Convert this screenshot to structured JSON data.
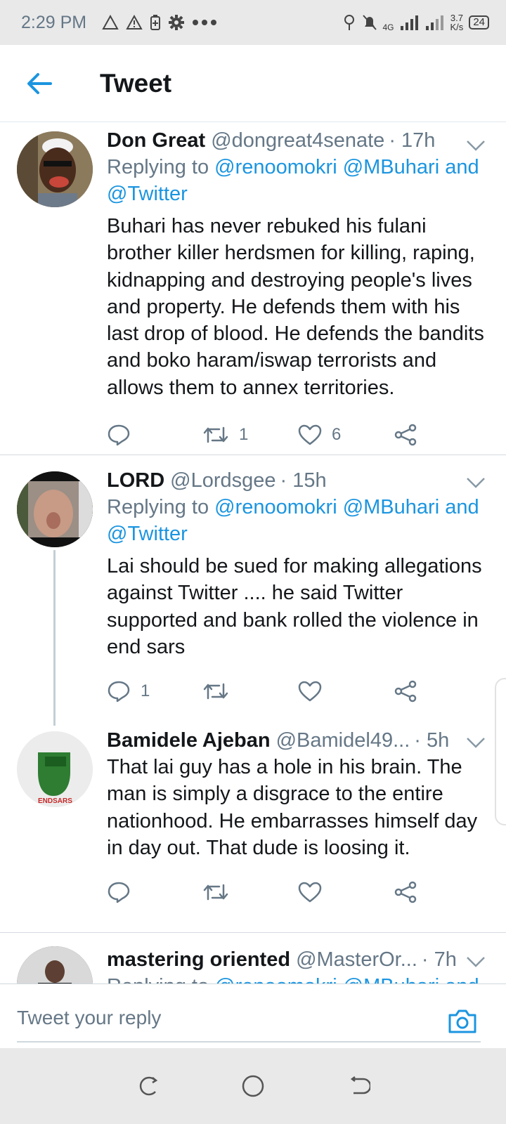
{
  "statusbar": {
    "time": "2:29 PM",
    "left_icons": [
      "warning-outline-icon",
      "warning-icon",
      "battery-saver-icon",
      "gear-icon",
      "more-dots-icon"
    ],
    "network": "4G",
    "speed_value": "3.7",
    "speed_unit": "K/s",
    "battery": "24"
  },
  "header": {
    "title": "Tweet"
  },
  "tweets": [
    {
      "name": "Don Great",
      "handle": "@dongreat4senate",
      "time": "· 17h",
      "reply_prefix": "Replying to",
      "reply_to_line1": "@renoomokri @MBuhari and",
      "reply_to_line2": "@Twitter",
      "text": "Buhari has never rebuked his fulani brother killer herdsmen for killing, raping, kidnapping and destroying people's lives and property. He defends them with his last drop of blood. He defends the bandits and boko haram/iswap terrorists and allows them to annex territories.",
      "replies": "",
      "retweets": "1",
      "likes": "6"
    },
    {
      "name": "LORD",
      "handle": "@Lordsgee",
      "time": "· 15h",
      "reply_prefix": "Replying to",
      "reply_to_line1": "@renoomokri @MBuhari and",
      "reply_to_line2": "@Twitter",
      "text": "Lai should be sued for making allegations against Twitter .... he said Twitter supported and bank rolled the violence in end sars",
      "replies": "1",
      "retweets": "",
      "likes": ""
    },
    {
      "name": "Bamidele Ajeban",
      "handle": "@Bamidel49...",
      "time": "· 5h",
      "text": "That lai guy has a hole in his brain. The man is simply a disgrace to the entire nationhood. He embarrasses himself day in day out. That dude is loosing it.",
      "avatar_text": "ENDSARS",
      "replies": "",
      "retweets": "",
      "likes": ""
    },
    {
      "name": "mastering oriented",
      "handle": "@MasterOr...",
      "time": "· 7h",
      "reply_prefix": "Replying to",
      "reply_to_line1": "@renoomokri @MBuhari and"
    }
  ],
  "composer": {
    "placeholder": "Tweet your reply"
  },
  "colors": {
    "accent": "#1b95e0",
    "muted": "#657786",
    "text": "#14171a"
  }
}
